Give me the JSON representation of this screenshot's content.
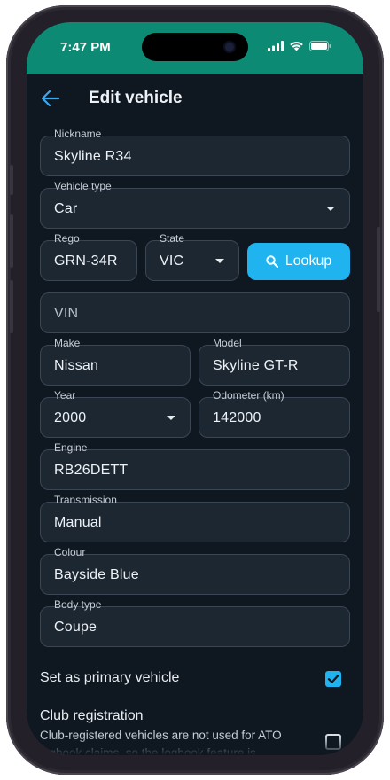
{
  "status_bar": {
    "time": "7:47 PM"
  },
  "app_bar": {
    "title": "Edit vehicle"
  },
  "form": {
    "nickname": {
      "label": "Nickname",
      "value": "Skyline R34"
    },
    "vehicle_type": {
      "label": "Vehicle type",
      "value": "Car"
    },
    "rego": {
      "label": "Rego",
      "value": "GRN-34R"
    },
    "state": {
      "label": "State",
      "value": "VIC"
    },
    "lookup_label": "Lookup",
    "vin": {
      "placeholder": "VIN"
    },
    "make": {
      "label": "Make",
      "value": "Nissan"
    },
    "model": {
      "label": "Model",
      "value": "Skyline GT-R"
    },
    "year": {
      "label": "Year",
      "value": "2000"
    },
    "odometer": {
      "label": "Odometer (km)",
      "value": "142000"
    },
    "engine": {
      "label": "Engine",
      "value": "RB26DETT"
    },
    "transmission": {
      "label": "Transmission",
      "value": "Manual"
    },
    "colour": {
      "label": "Colour",
      "value": "Bayside Blue"
    },
    "body_type": {
      "label": "Body type",
      "value": "Coupe"
    }
  },
  "primary": {
    "label": "Set as primary vehicle",
    "checked": true
  },
  "club": {
    "title": "Club registration",
    "description": "Club-registered vehicles are not used for ATO logbook claims, so the logbook feature is",
    "checked": false
  },
  "colors": {
    "status_bar": "#0d8a74",
    "accent": "#1fb3f0",
    "background": "#0f1720",
    "field_bg": "#1d2732"
  }
}
